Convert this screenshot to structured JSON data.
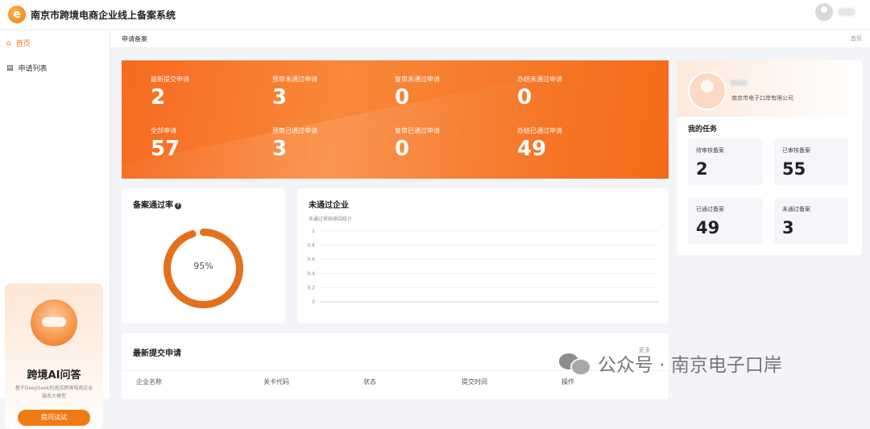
{
  "app": {
    "title": "南京市跨境电商企业线上备案系统",
    "logo_letter": "e"
  },
  "sidebar": {
    "items": [
      {
        "label": "首页",
        "icon": "home-icon",
        "active": true
      },
      {
        "label": "申请列表",
        "icon": "list-icon",
        "active": false
      }
    ],
    "ai_card": {
      "title": "跨境AI问答",
      "description": "基于DeepSeek的南京跨境电商企业服务大模型",
      "button_label": "提问试试"
    }
  },
  "breadcrumb": {
    "current": "申请备案",
    "home": "首页"
  },
  "stats": [
    {
      "label": "最新提交申请",
      "value": "2"
    },
    {
      "label": "预审未通过申请",
      "value": "3"
    },
    {
      "label": "复审未通过申请",
      "value": "0"
    },
    {
      "label": "办结未通过申请",
      "value": "0"
    },
    {
      "label": "全部申请",
      "value": "57"
    },
    {
      "label": "预审已通过申请",
      "value": "3"
    },
    {
      "label": "复审已通过申请",
      "value": "0"
    },
    {
      "label": "办结已通过申请",
      "value": "49"
    }
  ],
  "profile": {
    "company": "南京市电子口岸有限公司",
    "tasks_title": "我的任务",
    "tasks": [
      {
        "label": "待审核备案",
        "value": "2"
      },
      {
        "label": "已审核备案",
        "value": "55"
      },
      {
        "label": "已通过备案",
        "value": "49"
      },
      {
        "label": "未通过备案",
        "value": "3"
      }
    ]
  },
  "pass_rate": {
    "title": "备案通过率",
    "help": "?",
    "percent": 95,
    "label": "95%"
  },
  "failed": {
    "title": "未通过企业",
    "subtitle": "未通过审核原因统计",
    "chart_data": {
      "type": "bar",
      "categories": [],
      "values": [],
      "title": "",
      "xlabel": "",
      "ylabel": "",
      "ylim": [
        0,
        1
      ],
      "yticks": [
        "1",
        "0.8",
        "0.6",
        "0.4",
        "0.2",
        "0"
      ],
      "grid": true
    }
  },
  "latest": {
    "title": "最新提交申请",
    "more": "更多",
    "columns": [
      "企业名称",
      "关卡代码",
      "状态",
      "提交时间",
      "操作"
    ]
  },
  "watermark": {
    "text": "公众号 · 南京电子口岸"
  },
  "colors": {
    "accent": "#f07b14",
    "banner": "#f67b2c",
    "ring": "#e2701c"
  }
}
